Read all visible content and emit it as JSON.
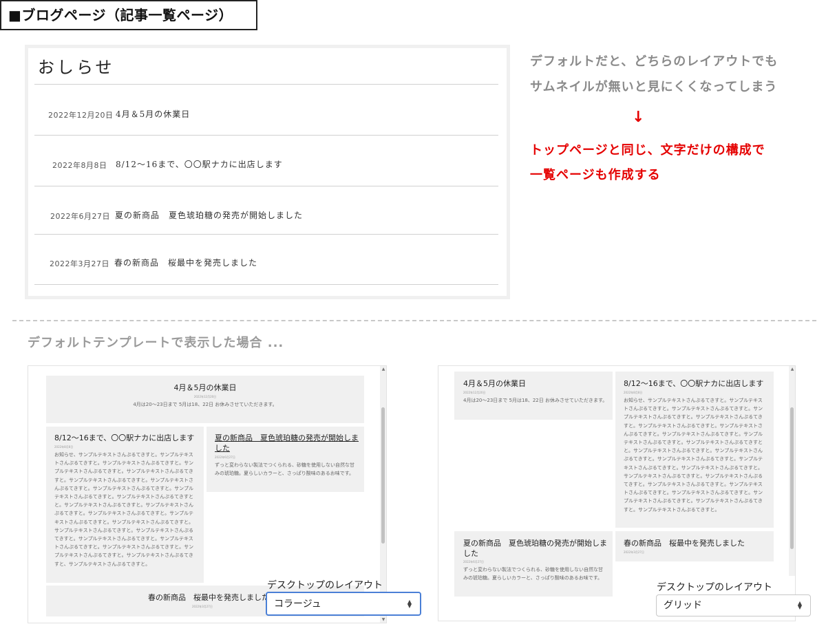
{
  "header": {
    "title": "■ブログページ（記事一覧ページ）"
  },
  "blog": {
    "title": "おしらせ",
    "rows": [
      {
        "date": "2022年12月20日",
        "title": "4月＆5月の休業日"
      },
      {
        "date": "2022年8月8日",
        "title": "8/12〜16まで、〇〇駅ナカに出店します"
      },
      {
        "date": "2022年6月27日",
        "title": "夏の新商品　夏色琥珀糖の発売が開始しました"
      },
      {
        "date": "2022年3月27日",
        "title": "春の新商品　桜最中を発売しました"
      }
    ]
  },
  "notes": {
    "line1": "デフォルトだと、どちらのレイアウトでも",
    "line2": "サムネイルが無いと見にくくなってしまう",
    "arrow": "↓",
    "red1": "トップページと同じ、文字だけの構成で",
    "red2": "一覧ページも作成する"
  },
  "section_caption": "デフォルトテンプレートで表示した場合 ...",
  "collage": {
    "post1": {
      "title": "4月＆5月の休業日",
      "date": "2022年12月20日",
      "body": "4月は20〜23日まで 5月は18、22日 お休みさせていただきます。"
    },
    "post2": {
      "title": "8/12〜16まで、〇〇駅ナカに出店します",
      "date": "2022年8月8日",
      "lines": [
        "お知らせ、サンプルテキストさんぷるてきすと。サンプルテキス",
        "トさんぷるてきすと。サンプルテキストさんぷるてきすと。サン",
        "プルテキストさんぷるてきすと。サンプルテキストさんぷるてき",
        "すと。サンプルテキストさんぷるてきすと。サンプルテキストさ",
        "んぷるてきすと。サンプルテキストさんぷるてきすと。サンプル",
        "テキストさんぷるてきすと。サンプルテキストさんぷるてきすと",
        "と。サンプルテキストさんぷるてきすと。サンプルテキストさん",
        "ぷるてきすと。サンプルテキストさんぷるてきすと。サンプルテ",
        "キストさんぷるてきすと。サンプルテキストさんぷるてきすと。",
        "サンプルテキストさんぷるてきすと。サンプルテキストさんぷる",
        "てきすと。サンプルテキストさんぷるてきすと。サンプルテキス",
        "トさんぷるてきすと。サンプルテキストさんぷるてきすと。サン",
        "プルテキストさんぷるてきすと。サンプルテキストさんぷるてき",
        "すと、サンプルテキストさんぷるてきすと。"
      ]
    },
    "post3": {
      "title_line1": "夏の新商品　夏色琥珀糖の発売が開始しま",
      "title_line2": "した",
      "date": "2022年6月27日",
      "body_line1": "ずっと変わらない製法でつくられる、砂糖を使用しない自然な甘",
      "body_line2": "みの琥珀糖。夏らしいカラーと、さっぱり酸味のあるお味です。"
    },
    "post4": {
      "title": "春の新商品　桜最中を発売しました",
      "date": "2022年3月27日"
    },
    "layout_label": "デスクトップのレイアウト",
    "layout_value": "コラージュ"
  },
  "grid": {
    "post1": {
      "title": "4月＆5月の休業日",
      "date": "2022年12月20日",
      "body": "4月は20〜23日まで 5月は18、22日 お休みさせていただきます。"
    },
    "post2": {
      "title": "8/12〜16まで、〇〇駅ナカに出店します",
      "date": "2022年8月8日",
      "lines": [
        "お知らせ、サンプルテキストさんぷるてきすと。サンプルテキス",
        "トさんぷるてきすと。サンプルテキストさんぷるてきすと。サン",
        "プルテキストさんぷるてきすと。サンプルテキストさんぷるてき",
        "すと。サンプルテキストさんぷるてきすと。サンプルテキストさ",
        "んぷるてきすと。サンプルテキストさんぷるてきすと。サンプル",
        "テキストさんぷるてきすと。サンプルテキストさんぷるてきすと",
        "と。サンプルテキストさんぷるてきすと。サンプルテキストさん",
        "ぷるてきすと。サンプルテキストさんぷるてきすと。サンプルテ",
        "キストさんぷるてきすと。サンプルテキストさんぷるてきすと。",
        "サンプルテキストさんぷるてきすと。サンプルテキストさんぷる",
        "てきすと。サンプルテキストさんぷるてきすと。サンプルテキス",
        "トさんぷるてきすと。サンプルテキストさんぷるてきすと。サン",
        "プルテキストさんぷるてきすと。サンプルテキストさんぷるてき",
        "すと。サンプルテキストさんぷるてきすと。"
      ]
    },
    "post3": {
      "title_line1": "夏の新商品　夏色琥珀糖の発売が開始しま",
      "title_line2": "した",
      "date": "2022年6月27日",
      "body_line1": "ずっと変わらない製法でつくられる、砂糖を使用しない自然な甘",
      "body_line2": "みの琥珀糖。夏らしいカラーと、さっぱり酸味のあるお味です。"
    },
    "post4": {
      "title": "春の新商品　桜最中を発売しました",
      "date": "2022年3月27日"
    },
    "layout_label": "デスクトップのレイアウト",
    "layout_value": "グリッド"
  },
  "colors": {
    "accent_red": "#e50000",
    "select_focus": "#4a7fd6",
    "card_bg": "#f0f0f0"
  }
}
